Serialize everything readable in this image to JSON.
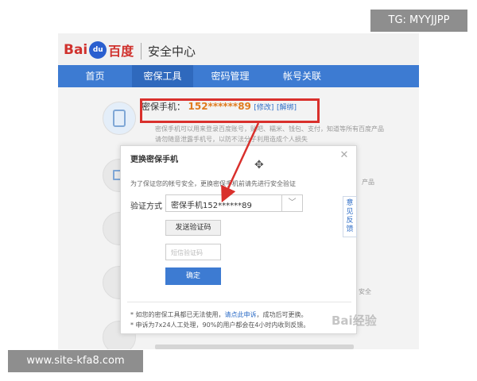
{
  "header": {
    "logo_text": "Bai",
    "logo_paw": "du",
    "logo_cn": "百度",
    "site_title": "安全中心"
  },
  "nav": {
    "items": [
      {
        "label": "首页"
      },
      {
        "label": "密保工具"
      },
      {
        "label": "密码管理"
      },
      {
        "label": "帐号关联"
      }
    ],
    "active_index": 1
  },
  "phone_row": {
    "label": "密保手机：",
    "number": "152******89",
    "modify_link": "[修改]",
    "unbind_link": "[解绑]"
  },
  "background_text": {
    "row1_line1": "密保手机可以用来登录百度账号，贴吧、糯米、钱包、支付，知道等所有百度产品",
    "row1_line2": "请勿随意泄露手机号，以防不法分子利用造成个人损失",
    "row2_tail": "产品",
    "row5_tail": "安全"
  },
  "modal": {
    "title": "更换密保手机",
    "close_icon": "close-icon",
    "description": "为了保证您的帐号安全，更换密保手机前请先进行安全验证",
    "verify_label": "验证方式",
    "verify_value": "密保手机152******89",
    "send_code_button": "发送验证码",
    "code_placeholder": "短信验证码",
    "confirm_button": "确定",
    "note1_prefix": "* 如您的密保工具都已无法使用，",
    "note1_link": "请点此申诉",
    "note1_suffix": "，成功后可更换。",
    "note2": "* 申诉为7x24人工处理，90%的用户都会在4小时内收到反馈。"
  },
  "feedback_tab": "意见反馈",
  "overlay": {
    "tg_badge": "TG: MYYJJPP",
    "site_badge": "www.site-kfa8.com",
    "watermark": "Bai经验"
  },
  "colors": {
    "nav_blue": "#3d7bd2",
    "highlight_red": "#d9302c",
    "phone_orange": "#e07b1e",
    "link_blue": "#2f6ec7"
  }
}
